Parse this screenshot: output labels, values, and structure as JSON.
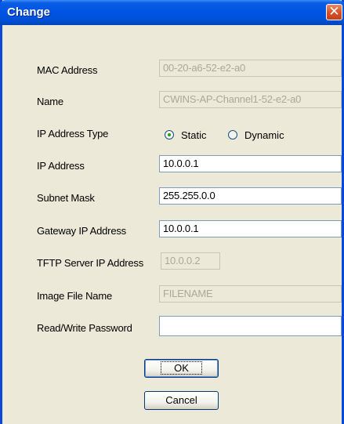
{
  "window": {
    "title": "Change"
  },
  "icons": {
    "close": "close-icon"
  },
  "fields": {
    "mac_address": {
      "label": "MAC Address",
      "value": "00-20-a6-52-e2-a0"
    },
    "name": {
      "label": "Name",
      "value": "CWINS-AP-Channel1-52-e2-a0"
    },
    "ip_address_type": {
      "label": "IP Address Type",
      "options": {
        "static": "Static",
        "dynamic": "Dynamic"
      },
      "selected": "Static"
    },
    "ip_address": {
      "label": "IP Address",
      "value": "10.0.0.1"
    },
    "subnet_mask": {
      "label": "Subnet Mask",
      "value": "255.255.0.0"
    },
    "gateway_ip": {
      "label": "Gateway IP Address",
      "value": "10.0.0.1"
    },
    "tftp_server_ip": {
      "label": "TFTP Server IP Address",
      "value": "10.0.0.2"
    },
    "image_file_name": {
      "label": "Image File Name",
      "value": "FILENAME"
    },
    "read_write_password": {
      "label": "Read/Write Password",
      "value": ""
    }
  },
  "buttons": {
    "ok": "OK",
    "cancel": "Cancel"
  },
  "colors": {
    "titlebar": "#0054e3",
    "dialog_bg": "#ece9d8",
    "close_button": "#d9532a"
  }
}
